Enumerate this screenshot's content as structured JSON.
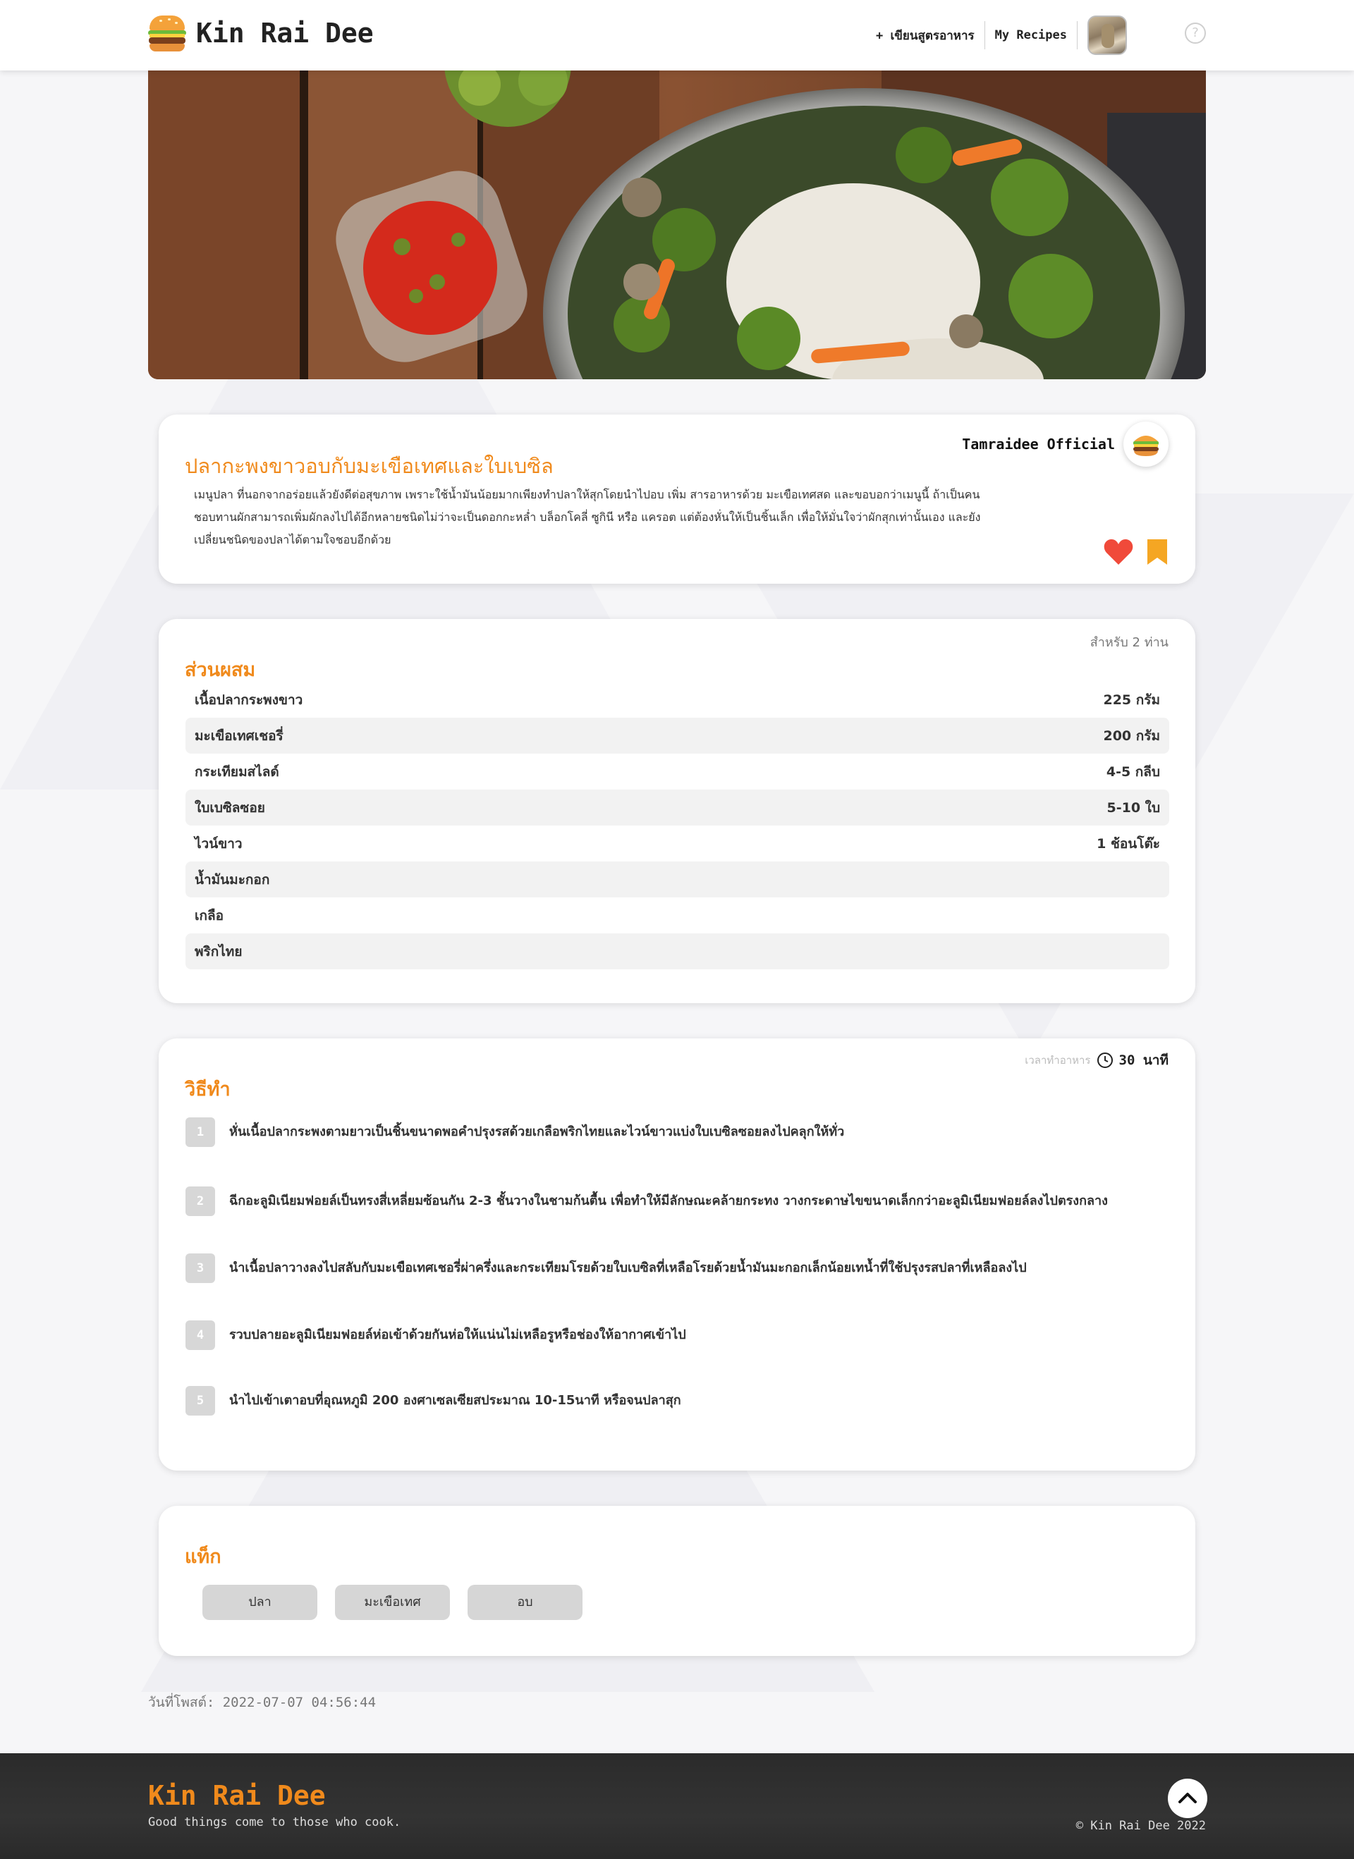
{
  "header": {
    "brand": "Kin Rai Dee",
    "nav_write": "+ เขียนสูตรอาหาร",
    "nav_my_recipes": "My Recipes",
    "help_glyph": "?"
  },
  "recipe": {
    "title": "ปลากะพงขาวอบกับมะเขือเทศและใบเบซิล",
    "description": "เมนูปลา ที่นอกจากอร่อยแล้วยังดีต่อสุขภาพ เพราะใช้น้ำมันน้อยมากเพียงทำปลาให้สุกโดยนำไปอบ เพิ่ม สารอาหารด้วย มะเขือเทศสด และขอบอกว่าเมนูนี้ ถ้าเป็นคนชอบทานผักสามารถเพิ่มผักลงไปได้อีกหลายชนิดไม่ว่าจะเป็นดอกกะหล่ำ บล็อกโคลี่ ซูกินี หรือ แครอต แต่ต้องหั่นให้เป็นชิ้นเล็ก เพื่อให้มั่นใจว่าผักสุกเท่านั้นเอง และยังเปลี่ยนชนิดของปลาได้ตามใจชอบอีกด้วย",
    "author": "Tamraidee Official"
  },
  "ingredients": {
    "title": "ส่วนผสม",
    "serves": "สำหรับ 2 ท่าน",
    "items": [
      {
        "name": "เนื้อปลากระพงขาว",
        "amount": "225 กรัม"
      },
      {
        "name": "มะเขือเทศเชอรี่",
        "amount": "200 กรัม"
      },
      {
        "name": "กระเทียมสไลด์",
        "amount": "4-5 กลีบ"
      },
      {
        "name": "ใบเบซิลซอย",
        "amount": "5-10 ใบ"
      },
      {
        "name": "ไวน์ขาว",
        "amount": "1 ช้อนโต๊ะ"
      },
      {
        "name": "น้ำมันมะกอก",
        "amount": ""
      },
      {
        "name": "เกลือ",
        "amount": ""
      },
      {
        "name": "พริกไทย",
        "amount": ""
      }
    ]
  },
  "method": {
    "title": "วิธีทำ",
    "cook_label": "เวลาทำอาหาร",
    "cook_time": "30 นาที",
    "steps": [
      {
        "num": "1",
        "text": "หั่นเนื้อปลากระพงตามยาวเป็นชิ้นขนาดพอคำปรุงรสด้วยเกลือพริกไทยและไวน์ขาวแบ่งใบเบซิลซอยลงไปคลุกให้ทั่ว"
      },
      {
        "num": "2",
        "text": "ฉีกอะลูมิเนียมฟอยล์เป็นทรงสี่เหลี่ยมซ้อนกัน 2-3 ชั้นวางในชามก้นตื้น เพื่อทำให้มีลักษณะคล้ายกระทง วางกระดาษไขขนาดเล็กกว่าอะลูมิเนียมฟอยล์ลงไปตรงกลาง"
      },
      {
        "num": "3",
        "text": "นำเนื้อปลาวางลงไปสลับกับมะเขือเทศเชอรี่ผ่าครึ่งและกระเทียมโรยด้วยใบเบซิลที่เหลือโรยด้วยน้ำมันมะกอกเล็กน้อยเทน้ำที่ใช้ปรุงรสปลาที่เหลือลงไป"
      },
      {
        "num": "4",
        "text": "รวบปลายอะลูมิเนียมฟอยล์ห่อเข้าด้วยกันห่อให้แน่นไม่เหลือรูหรือช่องให้อากาศเข้าไป"
      },
      {
        "num": "5",
        "text": "นำไปเข้าเตาอบที่อุณหภูมิ 200 องศาเซลเซียสประมาณ 10-15นาที หรือจนปลาสุก"
      }
    ]
  },
  "tags": {
    "title": "แท็ก",
    "items": [
      "ปลา",
      "มะเขือเทศ",
      "อบ"
    ]
  },
  "posted": "วันที่โพสต์: 2022-07-07 04:56:44",
  "footer": {
    "brand": "Kin Rai Dee",
    "tagline": "Good things come to those who cook.",
    "copyright": "© Kin Rai Dee 2022"
  },
  "colors": {
    "accent": "#f08a1c",
    "heart": "#f04a3a",
    "bookmark": "#f5a623",
    "footer_bg": "#2b2b2b"
  },
  "icons": [
    "burger-logo-icon",
    "help-icon",
    "heart-icon",
    "bookmark-icon",
    "clock-icon",
    "chevron-up-icon"
  ]
}
